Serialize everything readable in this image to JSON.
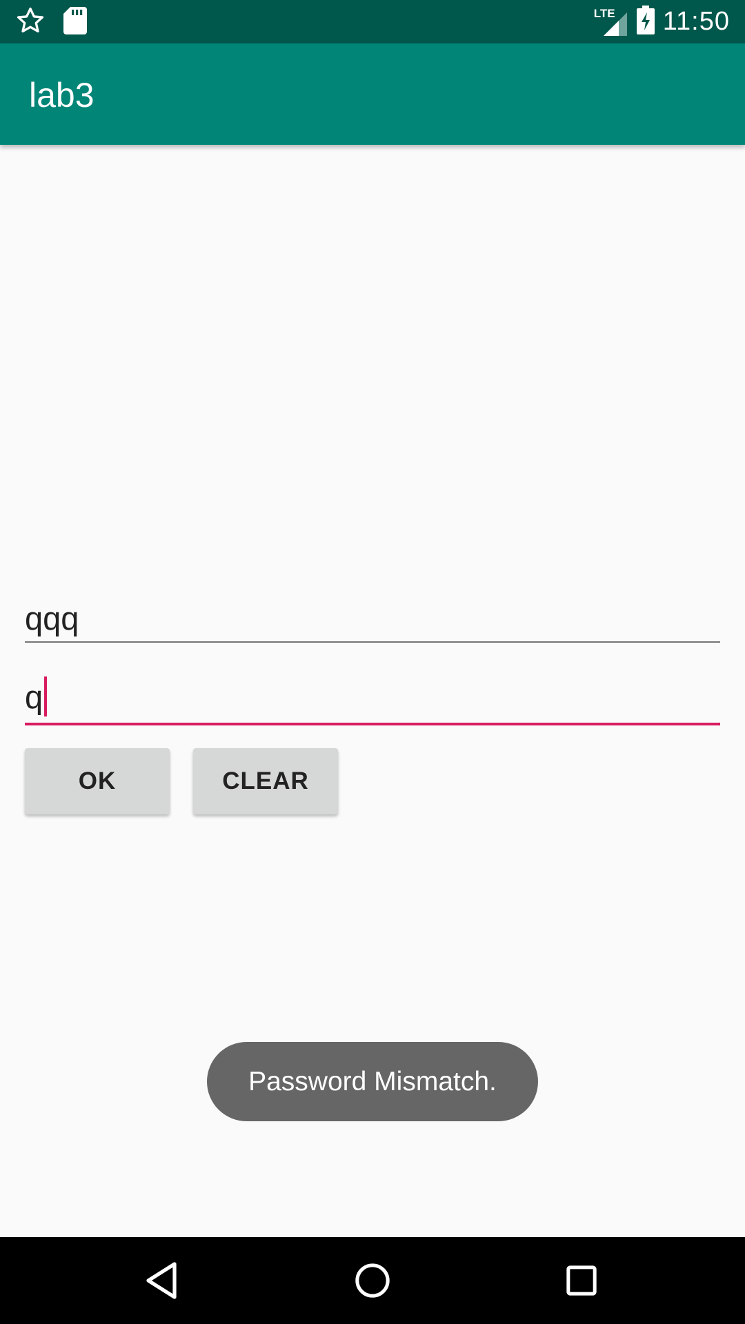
{
  "status_bar": {
    "time": "11:50",
    "network_label": "LTE",
    "icons": [
      "star-icon",
      "sd-card-icon",
      "lte-signal-icon",
      "battery-charging-icon"
    ]
  },
  "app_bar": {
    "title": "lab3",
    "color": "#008577"
  },
  "form": {
    "password_value": "qqq",
    "confirm_value": "q",
    "accent_color": "#d81b60"
  },
  "buttons": {
    "ok_label": "OK",
    "clear_label": "CLEAR"
  },
  "toast": {
    "message": "Password Mismatch."
  },
  "nav_bar": {
    "icons": [
      "back-icon",
      "home-icon",
      "recents-icon"
    ]
  }
}
